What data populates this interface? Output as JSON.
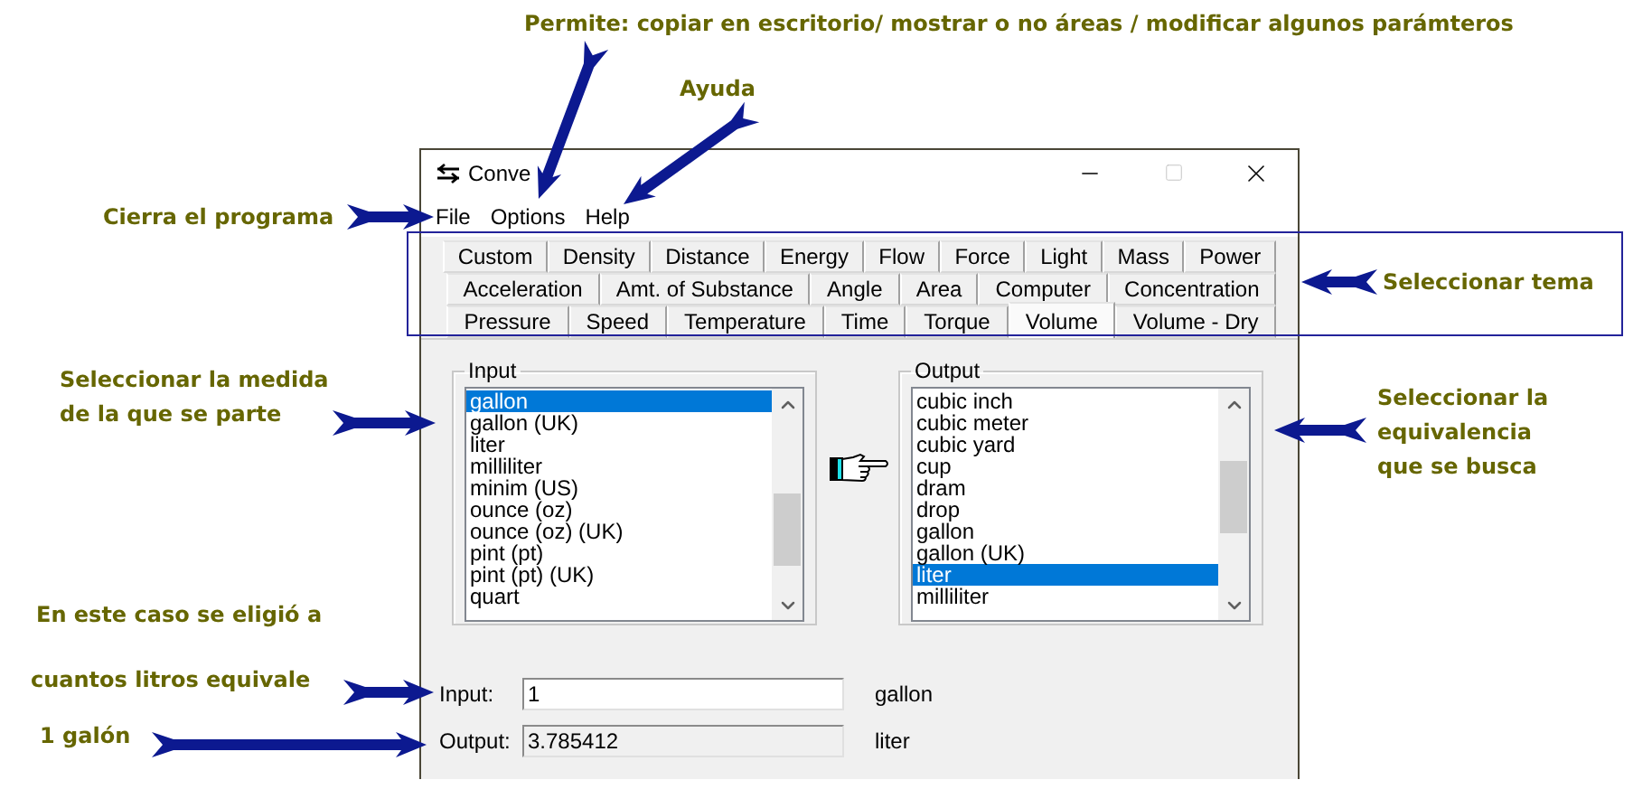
{
  "window": {
    "title": "Conve"
  },
  "menu": [
    "File",
    "Options",
    "Help"
  ],
  "tab_rows": [
    [
      {
        "label": "Custom",
        "selected": false
      },
      {
        "label": "Density",
        "selected": false
      },
      {
        "label": "Distance",
        "selected": false
      },
      {
        "label": "Energy",
        "selected": false
      },
      {
        "label": "Flow",
        "selected": false
      },
      {
        "label": "Force",
        "selected": false
      },
      {
        "label": "Light",
        "selected": false
      },
      {
        "label": "Mass",
        "selected": false
      },
      {
        "label": "Power",
        "selected": false
      }
    ],
    [
      {
        "label": "Acceleration",
        "selected": false
      },
      {
        "label": "Amt. of Substance",
        "selected": false
      },
      {
        "label": "Angle",
        "selected": false
      },
      {
        "label": "Area",
        "selected": false
      },
      {
        "label": "Computer",
        "selected": false
      },
      {
        "label": "Concentration",
        "selected": false
      }
    ],
    [
      {
        "label": "Pressure",
        "selected": false
      },
      {
        "label": "Speed",
        "selected": false
      },
      {
        "label": "Temperature",
        "selected": false
      },
      {
        "label": "Time",
        "selected": false
      },
      {
        "label": "Torque",
        "selected": false
      },
      {
        "label": "Volume",
        "selected": true
      },
      {
        "label": "Volume - Dry",
        "selected": false
      }
    ]
  ],
  "lists": [
    {
      "label": "Input",
      "items": [
        {
          "label": "gallon",
          "selected": true
        },
        {
          "label": "gallon (UK)",
          "selected": false
        },
        {
          "label": "liter",
          "selected": false
        },
        {
          "label": "milliliter",
          "selected": false
        },
        {
          "label": "minim (US)",
          "selected": false
        },
        {
          "label": "ounce (oz)",
          "selected": false
        },
        {
          "label": "ounce (oz) (UK)",
          "selected": false
        },
        {
          "label": "pint (pt)",
          "selected": false
        },
        {
          "label": "pint (pt) (UK)",
          "selected": false
        },
        {
          "label": "quart",
          "selected": false
        }
      ]
    },
    {
      "label": "Output",
      "items": [
        {
          "label": "cubic inch",
          "selected": false
        },
        {
          "label": "cubic meter",
          "selected": false
        },
        {
          "label": "cubic yard",
          "selected": false
        },
        {
          "label": "cup",
          "selected": false
        },
        {
          "label": "dram",
          "selected": false
        },
        {
          "label": "drop",
          "selected": false
        },
        {
          "label": "gallon",
          "selected": false
        },
        {
          "label": "gallon (UK)",
          "selected": false
        },
        {
          "label": "liter",
          "selected": true
        },
        {
          "label": "milliliter",
          "selected": false
        }
      ]
    }
  ],
  "fields": [
    {
      "label": "Input:",
      "value": "1",
      "unit": "gallon",
      "kind": "editable"
    },
    {
      "label": "Output:",
      "value": "3.785412",
      "unit": "liter",
      "kind": "readonly"
    }
  ],
  "annotations": [
    {
      "lines": [
        "Permite: copiar en escritorio/ mostrar o no áreas / modificar algunos parámteros"
      ]
    },
    {
      "lines": [
        "Ayuda"
      ]
    },
    {
      "lines": [
        "Cierra el programa"
      ]
    },
    {
      "lines": [
        "Seleccionar tema"
      ]
    },
    {
      "lines": [
        "Seleccionar la medida",
        "de la que se parte"
      ]
    },
    {
      "lines": [
        "Seleccionar la",
        "equivalencia",
        "que se busca"
      ]
    },
    {
      "lines": [
        "En este caso se eligió a"
      ]
    },
    {
      "lines": [
        "cuantos litros equivale"
      ]
    },
    {
      "lines": [
        "1 galón"
      ]
    }
  ]
}
